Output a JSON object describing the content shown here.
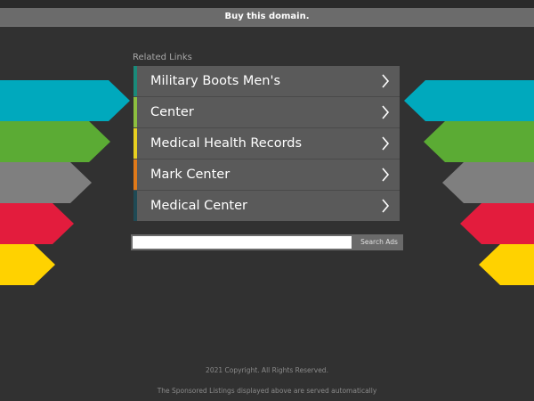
{
  "header": {
    "buy_label": "Buy this domain."
  },
  "related": {
    "title": "Related Links",
    "links": [
      {
        "label": "Military Boots Men's",
        "accent": "#1a8a7a"
      },
      {
        "label": "Center",
        "accent": "#8cbf3f"
      },
      {
        "label": "Medical Health Records",
        "accent": "#e8d020"
      },
      {
        "label": "Mark Center",
        "accent": "#e07a1a"
      },
      {
        "label": "Medical Center",
        "accent": "#1f4a55"
      }
    ]
  },
  "search": {
    "value": "",
    "button_label": "Search Ads"
  },
  "footer": {
    "copyright": "2021 Copyright. All Rights Reserved.",
    "note": "The Sponsored Listings displayed above are served automatically"
  },
  "colors": {
    "background": "#313131",
    "cyan": "#00a9bd",
    "green": "#5bab34",
    "gray": "#7f7f7f",
    "red": "#e31c3d",
    "yellow": "#ffd200"
  }
}
